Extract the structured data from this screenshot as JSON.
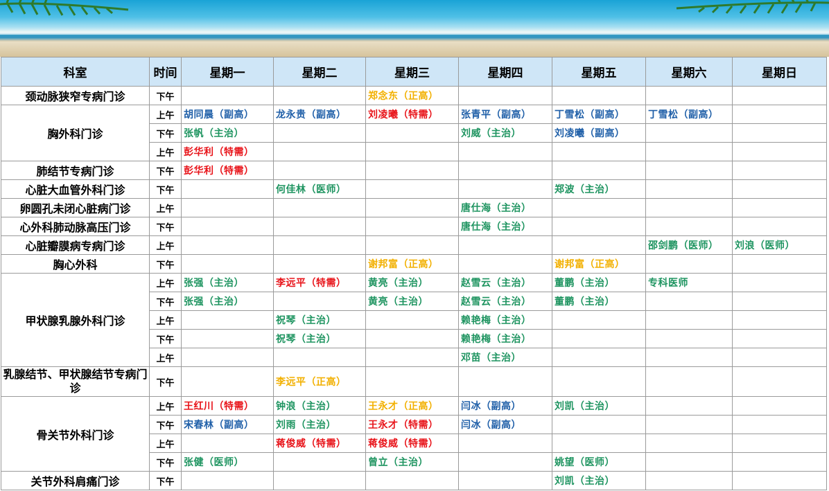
{
  "headers": {
    "dept": "科室",
    "time": "时间",
    "days": [
      "星期一",
      "星期二",
      "星期三",
      "星期四",
      "星期五",
      "星期六",
      "星期日"
    ]
  },
  "colors": {
    "blue": "#1f5fa8",
    "green": "#1e9460",
    "red": "#e8141a",
    "orange": "#f2b000",
    "header_bg": "#cfe6f7"
  },
  "departments": [
    "颈动脉狭窄专病门诊",
    "胸外科门诊",
    "肺结节专病门诊",
    "心脏大血管外科门诊",
    "卵圆孔未闭心脏病门诊",
    "心外科肺动脉高压门诊",
    "心脏瓣膜病专病门诊",
    "胸心外科",
    "甲状腺乳腺外科门诊",
    "乳腺结节、甲状腺结节专病门诊",
    "骨关节外科门诊",
    "关节外科肩痛门诊"
  ],
  "rows": [
    {
      "time": "下午",
      "cells": [
        "",
        "",
        "郑念东（正高）",
        "",
        "",
        "",
        ""
      ]
    },
    {
      "time": "上午",
      "cells": [
        "胡同晨（副高）",
        "龙永贵（副高）",
        "刘凌曦（特需）",
        "张青平（副高）",
        "丁雪松（副高）",
        "丁雪松（副高）",
        ""
      ]
    },
    {
      "time": "下午",
      "cells": [
        "张帆（主治）",
        "",
        "",
        "刘威（主治）",
        "刘凌曦（副高）",
        "",
        ""
      ]
    },
    {
      "time": "上午",
      "cells": [
        "彭华利（特需）",
        "",
        "",
        "",
        "",
        "",
        ""
      ]
    },
    {
      "time": "下午",
      "cells": [
        "彭华利（特需）",
        "",
        "",
        "",
        "",
        "",
        ""
      ]
    },
    {
      "time": "下午",
      "cells": [
        "",
        "何佳林（医师）",
        "",
        "",
        "郑波（主治）",
        "",
        ""
      ]
    },
    {
      "time": "上午",
      "cells": [
        "",
        "",
        "",
        "唐仕海（主治）",
        "",
        "",
        ""
      ]
    },
    {
      "time": "下午",
      "cells": [
        "",
        "",
        "",
        "唐仕海（主治）",
        "",
        "",
        ""
      ]
    },
    {
      "time": "上午",
      "cells": [
        "",
        "",
        "",
        "",
        "",
        "邵剑鹏（医师）",
        "刘浪（医师）"
      ]
    },
    {
      "time": "下午",
      "cells": [
        "",
        "",
        "谢邦富（正高）",
        "",
        "谢邦富（正高）",
        "",
        ""
      ]
    },
    {
      "time": "上午",
      "cells": [
        "张强（主治）",
        "李远平（特需）",
        "黄亮（主治）",
        "赵雪云（主治）",
        "董鹏（主治）",
        "专科医师",
        ""
      ]
    },
    {
      "time": "下午",
      "cells": [
        "张强（主治）",
        "",
        "黄亮（主治）",
        "赵雪云（主治）",
        "董鹏（主治）",
        "",
        ""
      ]
    },
    {
      "time": "上午",
      "cells": [
        "",
        "祝琴（主治）",
        "",
        "赖艳梅（主治）",
        "",
        "",
        ""
      ]
    },
    {
      "time": "下午",
      "cells": [
        "",
        "祝琴（主治）",
        "",
        "赖艳梅（主治）",
        "",
        "",
        ""
      ]
    },
    {
      "time": "上午",
      "cells": [
        "",
        "",
        "",
        "邓苗（主治）",
        "",
        "",
        ""
      ]
    },
    {
      "time": "下午",
      "cells": [
        "",
        "李远平（正高）",
        "",
        "",
        "",
        "",
        ""
      ]
    },
    {
      "time": "上午",
      "cells": [
        "王红川（特需）",
        "钟浪（主治）",
        "王永才（正高）",
        "闫冰（副高）",
        "刘凯（主治）",
        "",
        ""
      ]
    },
    {
      "time": "下午",
      "cells": [
        "宋春林（副高）",
        "刘雨（主治）",
        "王永才（特需）",
        "闫冰（副高）",
        "",
        "",
        ""
      ]
    },
    {
      "time": "上午",
      "cells": [
        "",
        "蒋俊威（特需）",
        "蒋俊威（特需）",
        "",
        "",
        "",
        ""
      ]
    },
    {
      "time": "下午",
      "cells": [
        "张健（医师）",
        "",
        "曾立（主治）",
        "",
        "姚望（医师）",
        "",
        ""
      ]
    },
    {
      "time": "下午",
      "cells": [
        "",
        "",
        "",
        "",
        "刘凯（主治）",
        "",
        ""
      ]
    }
  ]
}
